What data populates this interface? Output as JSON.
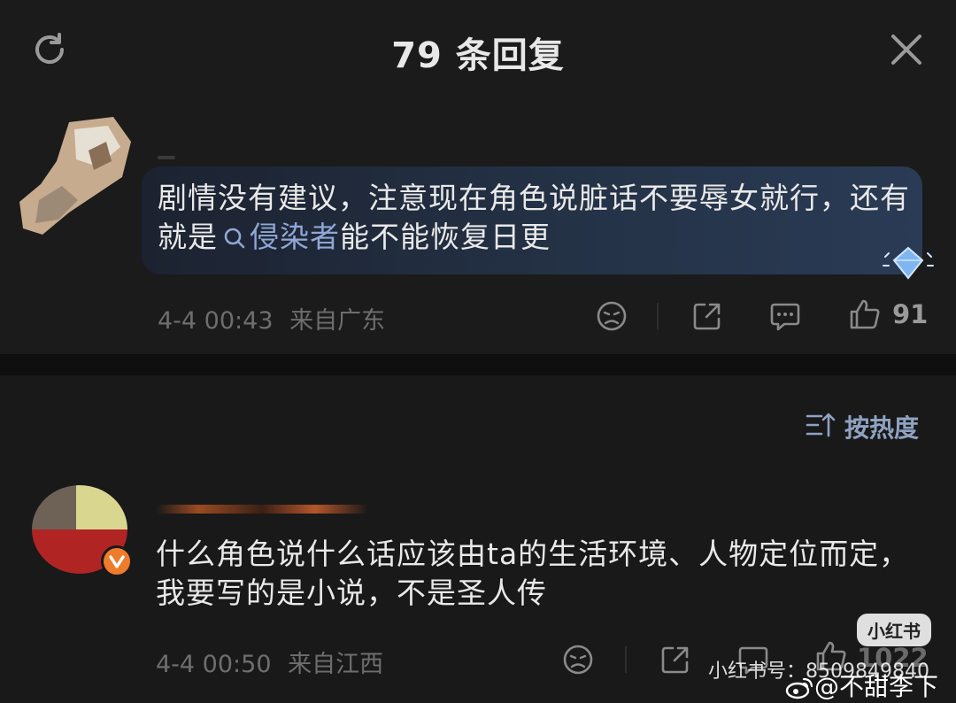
{
  "header": {
    "title": "79 条回复"
  },
  "top_comment": {
    "text_plain": "剧情没有建议，注意现在角色说脏话不要辱女就行，还有就是",
    "link": "侵染者",
    "text_after": "能不能恢复日更",
    "date": "4-4 00:43",
    "location": "来自广东",
    "like_count": "91"
  },
  "sort": {
    "label": "按热度"
  },
  "reply": {
    "text": "什么角色说什么话应该由ta的生活环境、人物定位而定，我要写的是小说，不是圣人传",
    "date": "4-4 00:50",
    "location": "来自江西",
    "like_count": "1022"
  },
  "watermark": {
    "box": "小红书",
    "id_text": "小红书号：8509849840",
    "weibo": "@不甜李下"
  }
}
